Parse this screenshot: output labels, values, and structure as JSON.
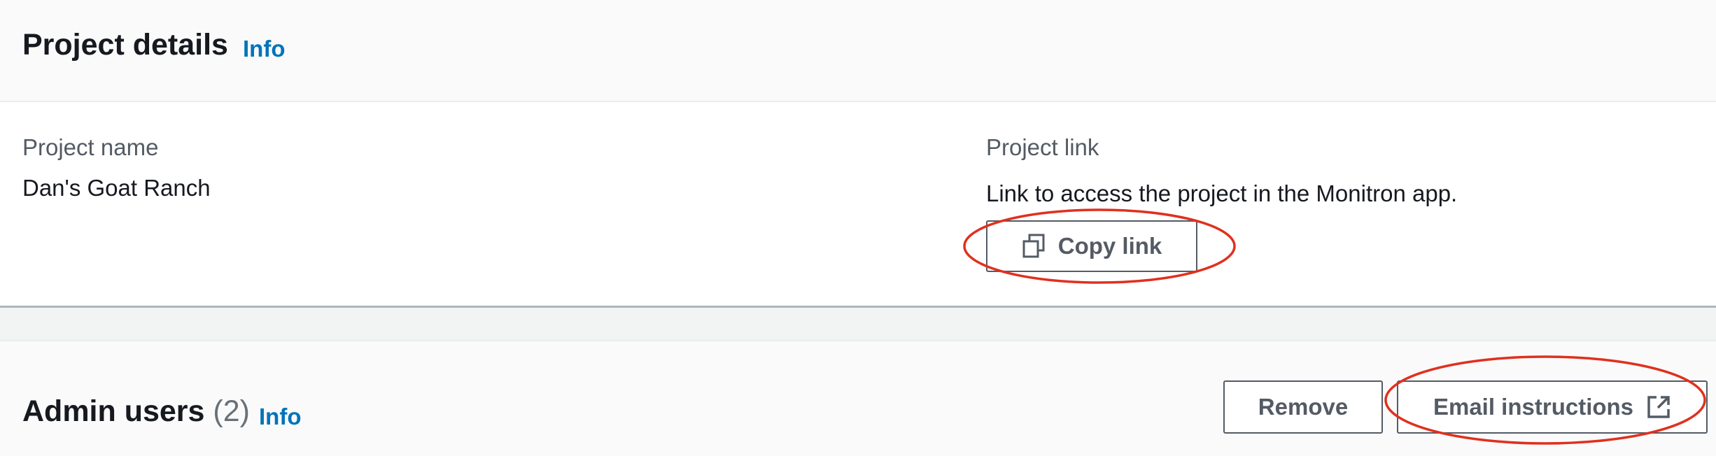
{
  "project_details": {
    "title": "Project details",
    "info_link": "Info",
    "project_name_label": "Project name",
    "project_name_value": "Dan's Goat Ranch",
    "project_link_label": "Project link",
    "project_link_description": "Link to access the project in the Monitron app.",
    "copy_link_button": "Copy link",
    "copy_icon": "copy-icon"
  },
  "admin_users": {
    "title": "Admin users",
    "count": "(2)",
    "info_link": "Info",
    "remove_button": "Remove",
    "email_instructions_button": "Email instructions",
    "external_icon": "external-link-icon"
  },
  "colors": {
    "link": "#0073bb",
    "annotation": "#e0301e",
    "button_border": "#545b64",
    "heading": "#16191f",
    "label": "#545b64"
  }
}
